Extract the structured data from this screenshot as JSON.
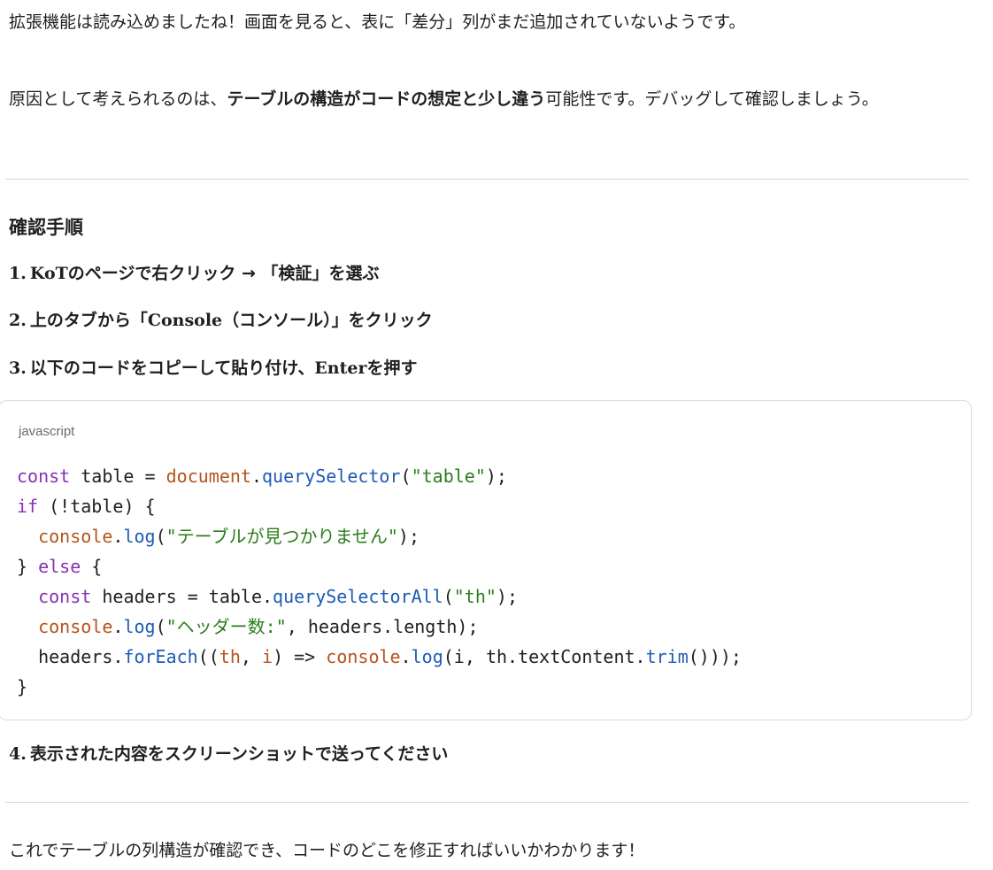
{
  "intro": {
    "p1": "拡張機能は読み込めましたね！画面を見ると、表に「差分」列がまだ追加されていないようです。",
    "p2_pre": "原因として考えられるのは、",
    "p2_bold": "テーブルの構造がコードの想定と少し違う",
    "p2_post": "可能性です。デバッグして確認しましょう。"
  },
  "section_title": "確認手順",
  "steps": [
    {
      "num": "1.",
      "text": "KoTのページで右クリック → 「検証」を選ぶ"
    },
    {
      "num": "2.",
      "text": "上のタブから「Console（コンソール）」をクリック"
    },
    {
      "num": "3.",
      "text": "以下のコードをコピーして貼り付け、Enterを押す"
    },
    {
      "num": "4.",
      "text": "表示された内容をスクリーンショットで送ってください"
    }
  ],
  "code": {
    "language": "javascript",
    "lines": [
      "const table = document.querySelector(\"table\");",
      "if (!table) {",
      "  console.log(\"テーブルが見つかりません\");",
      "} else {",
      "  const headers = table.querySelectorAll(\"th\");",
      "  console.log(\"ヘッダー数:\", headers.length);",
      "  headers.forEach((th, i) => console.log(i, th.textContent.trim()));",
      "}"
    ]
  },
  "closing": "これでテーブルの列構造が確認でき、コードのどこを修正すればいいかわかります！"
}
